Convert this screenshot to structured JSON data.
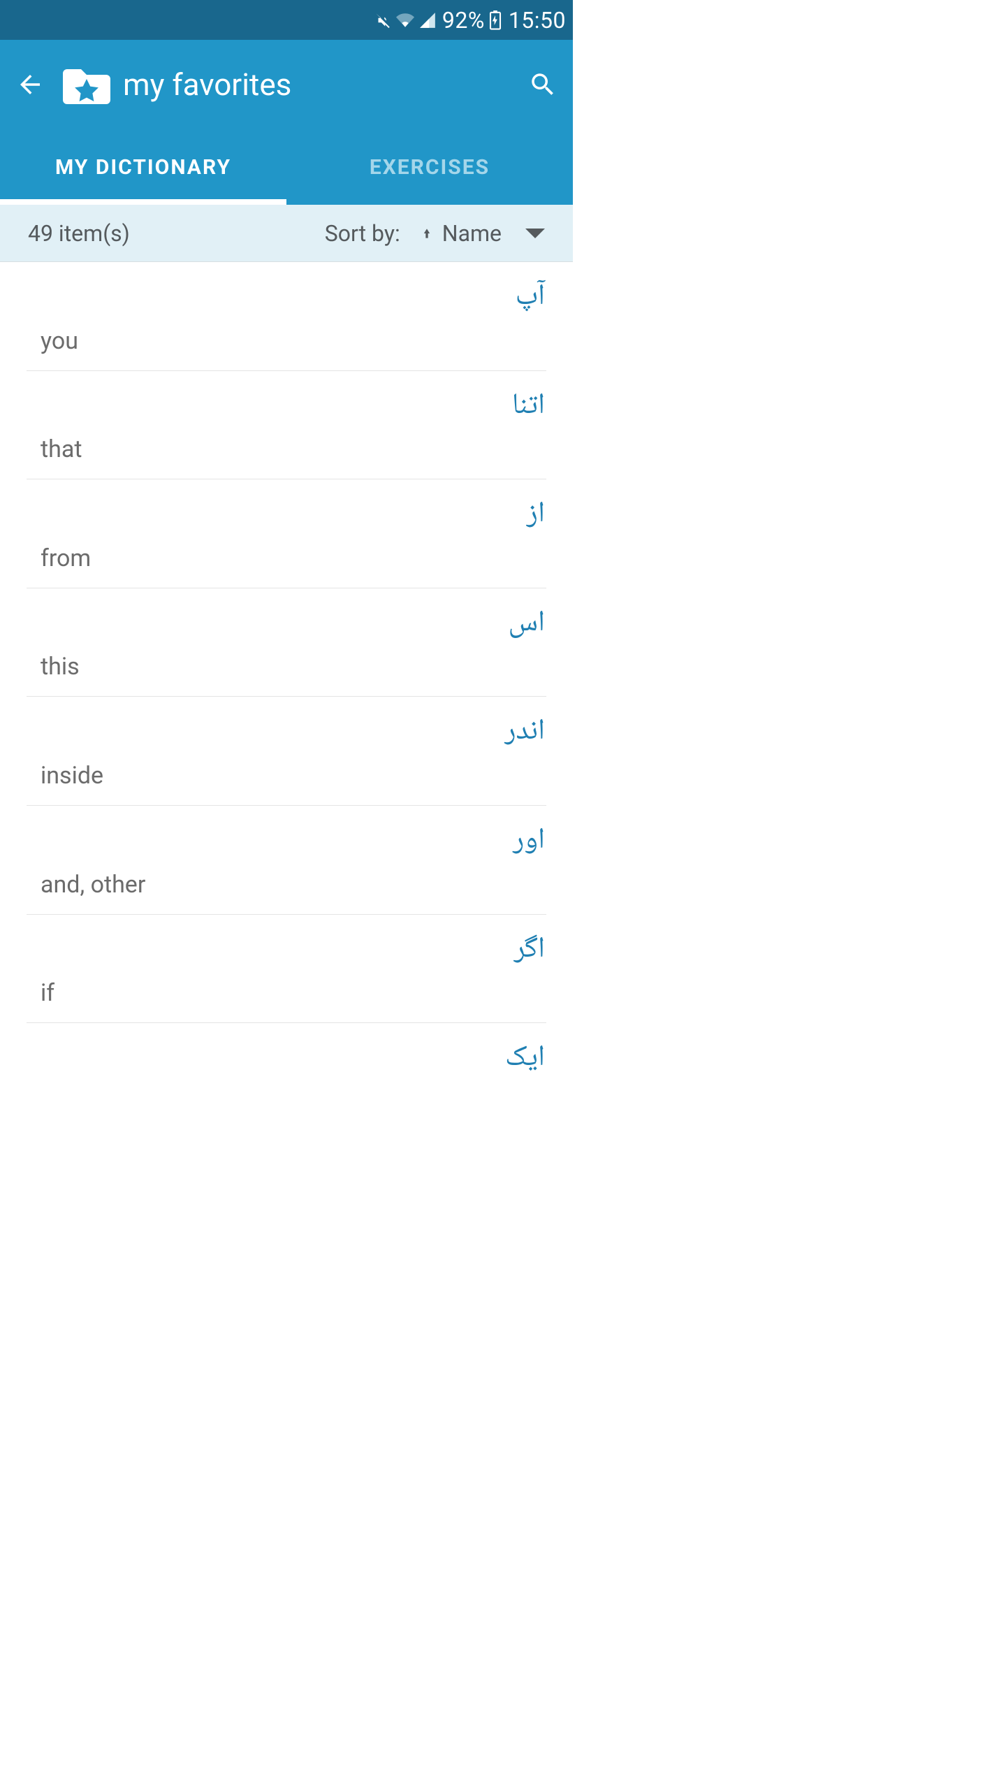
{
  "status": {
    "battery_pct": "92%",
    "time": "15:50"
  },
  "header": {
    "title": "my favorites"
  },
  "tabs": [
    {
      "label": "MY DICTIONARY",
      "active": true
    },
    {
      "label": "EXERCISES",
      "active": false
    }
  ],
  "sort": {
    "count_label": "49 item(s)",
    "sort_by_label": "Sort by:",
    "field": "Name"
  },
  "items": [
    {
      "term": "آپ",
      "translation": "you"
    },
    {
      "term": "اتنا",
      "translation": "that"
    },
    {
      "term": "از",
      "translation": "from"
    },
    {
      "term": "اس",
      "translation": "this"
    },
    {
      "term": "اندر",
      "translation": "inside"
    },
    {
      "term": "اور",
      "translation": "and, other"
    },
    {
      "term": "اگر",
      "translation": "if"
    },
    {
      "term": "ایک",
      "translation": ""
    }
  ]
}
